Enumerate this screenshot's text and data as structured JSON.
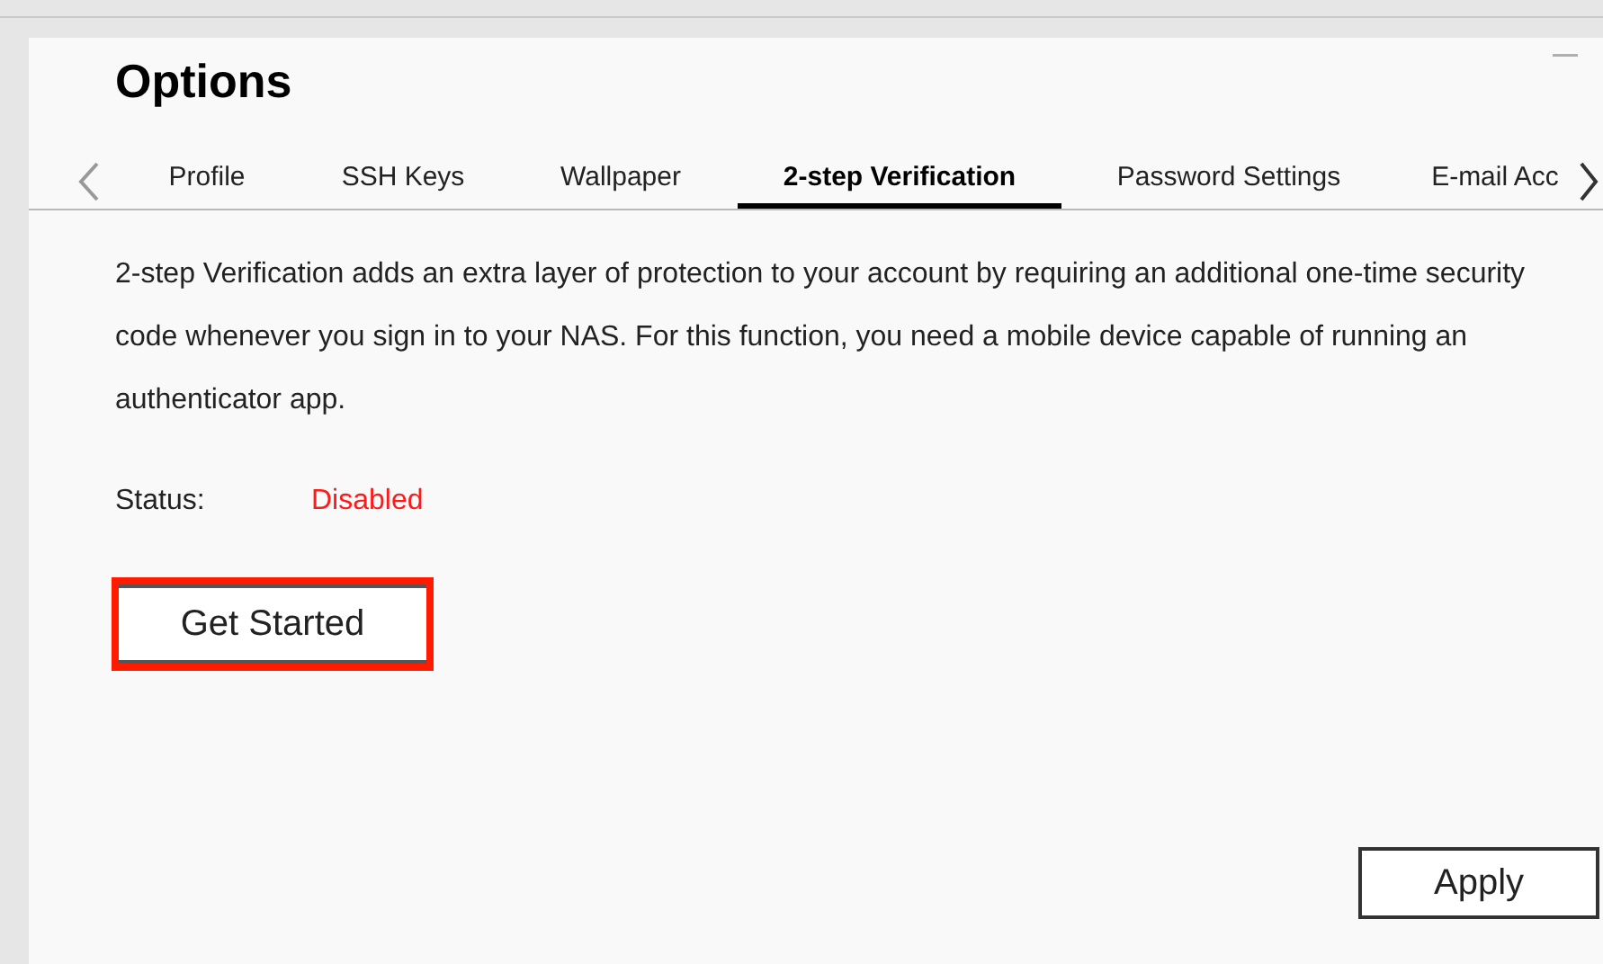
{
  "window": {
    "title": "Options"
  },
  "tabs": [
    {
      "label": "Profile",
      "selected": false
    },
    {
      "label": "SSH Keys",
      "selected": false
    },
    {
      "label": "Wallpaper",
      "selected": false
    },
    {
      "label": "2-step Verification",
      "selected": true
    },
    {
      "label": "Password Settings",
      "selected": false
    },
    {
      "label": "E-mail Acc",
      "selected": false
    }
  ],
  "description": "2-step Verification adds an extra layer of protection to your account by requiring an additional one-time security code whenever you sign in to your NAS. For this function, you need a mobile device capable of running an authenticator app.",
  "status": {
    "label": "Status:",
    "value": "Disabled",
    "enabled": false
  },
  "get_started_button": {
    "label": "Get Started",
    "highlighted": true
  },
  "apply_button": {
    "label": "Apply"
  }
}
